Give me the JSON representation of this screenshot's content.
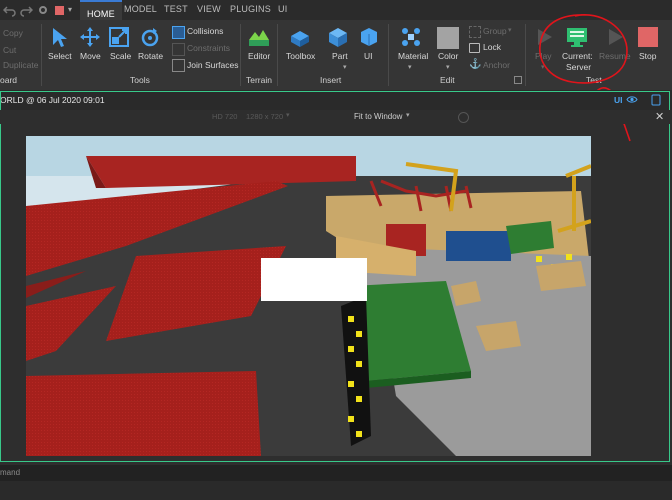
{
  "tabs": {
    "home": "HOME",
    "model": "MODEL",
    "test": "TEST",
    "view": "VIEW",
    "plugins": "PLUGINS",
    "ui": "UI"
  },
  "clipboard": {
    "copy": "Copy",
    "cut": "Cut",
    "duplicate": "Duplicate",
    "group": "oard"
  },
  "tools": {
    "select": "Select",
    "move": "Move",
    "scale": "Scale",
    "rotate": "Rotate",
    "collisions": "Collisions",
    "constraints": "Constraints",
    "join": "Join Surfaces",
    "group": "Tools"
  },
  "terrain": {
    "editor": "Editor",
    "group": "Terrain"
  },
  "insert": {
    "toolbox": "Toolbox",
    "part": "Part",
    "ui": "UI",
    "group": "Insert"
  },
  "edit": {
    "material": "Material",
    "color": "Color",
    "group_btn": "Group",
    "lock": "Lock",
    "anchor": "Anchor",
    "group": "Edit"
  },
  "test": {
    "play": "Play",
    "current": "Current:",
    "server": "Server",
    "resume": "Resume",
    "stop": "Stop",
    "group": "Test"
  },
  "viewport": {
    "tab_title": "ORLD @ 06 Jul 2020 09:01",
    "ui_label": "UI",
    "resolution": "HD 720",
    "size": "1280 x 720",
    "fit": "Fit to Window",
    "command": "mand"
  },
  "colors": {
    "accent": "#3a7bd5",
    "frame": "#38c98a",
    "annotation": "#e0141b"
  }
}
